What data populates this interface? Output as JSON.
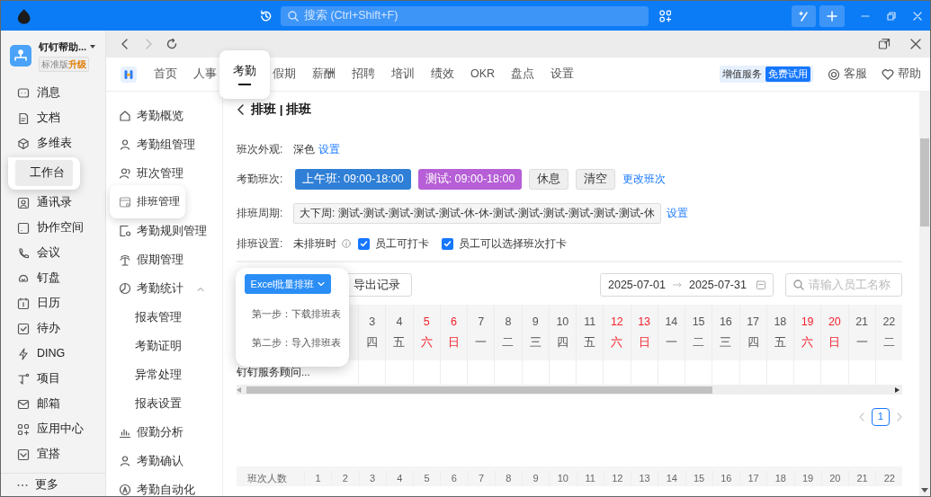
{
  "title_bar": {
    "search_placeholder": "搜索 (Ctrl+Shift+F)"
  },
  "org": {
    "name": "钉钉帮助...",
    "edition": "标准版",
    "upgrade": "升级"
  },
  "sidebar": {
    "items": [
      {
        "label": "消息",
        "selected": false
      },
      {
        "label": "文档",
        "selected": false
      },
      {
        "label": "多维表",
        "selected": false
      },
      {
        "label": "工作台",
        "selected": true
      },
      {
        "label": "通讯录",
        "selected": false
      },
      {
        "label": "协作空间",
        "selected": false
      },
      {
        "label": "会议",
        "selected": false
      },
      {
        "label": "钉盘",
        "selected": false
      },
      {
        "label": "日历",
        "selected": false
      },
      {
        "label": "待办",
        "selected": false
      },
      {
        "label": "DING",
        "selected": false
      },
      {
        "label": "项目",
        "selected": false
      },
      {
        "label": "邮箱",
        "selected": false
      },
      {
        "label": "应用中心",
        "selected": false
      },
      {
        "label": "宜搭",
        "selected": false
      }
    ],
    "more": "更多"
  },
  "app_tabs": [
    {
      "label": "首页",
      "selected": false
    },
    {
      "label": "人事",
      "selected": false
    },
    {
      "label": "考勤",
      "selected": true
    },
    {
      "label": "假期",
      "selected": false
    },
    {
      "label": "薪酬",
      "selected": false
    },
    {
      "label": "招聘",
      "selected": false
    },
    {
      "label": "培训",
      "selected": false
    },
    {
      "label": "绩效",
      "selected": false
    },
    {
      "label": "OKR",
      "selected": false
    },
    {
      "label": "盘点",
      "selected": false
    },
    {
      "label": "设置",
      "selected": false
    }
  ],
  "value_added": {
    "label": "增值服务",
    "badge": "免费试用"
  },
  "header_links": [
    {
      "label": "客服"
    },
    {
      "label": "帮助"
    }
  ],
  "menu": [
    {
      "label": "考勤概览",
      "selected": false
    },
    {
      "label": "考勤组管理",
      "selected": false
    },
    {
      "label": "班次管理",
      "selected": false
    },
    {
      "label": "排班管理",
      "selected": true
    },
    {
      "label": "考勤规则管理",
      "selected": false
    },
    {
      "label": "假期管理",
      "selected": false
    },
    {
      "label": "考勤统计",
      "selected": false,
      "expanded": true,
      "children": [
        {
          "label": "报表管理",
          "selected": false
        },
        {
          "label": "考勤证明",
          "selected": false
        },
        {
          "label": "异常处理",
          "selected": false
        },
        {
          "label": "报表设置",
          "selected": false
        }
      ]
    },
    {
      "label": "假勤分析",
      "selected": false
    },
    {
      "label": "考勤确认",
      "selected": false
    },
    {
      "label": "考勤自动化",
      "selected": false
    }
  ],
  "page": {
    "title": "排班 | 排班"
  },
  "appearance": {
    "label": "班次外观:",
    "value": "深色",
    "link": "设置"
  },
  "shifts": {
    "label": "考勤班次:",
    "items": [
      {
        "label": "上午班: 09:00-18:00",
        "kind": "shift",
        "color": "#2f7fd6"
      },
      {
        "label": "测试: 09:00-18:00",
        "kind": "shift",
        "color": "#b65fd6"
      },
      {
        "label": "休息",
        "kind": "plain"
      },
      {
        "label": "清空",
        "kind": "plain"
      }
    ],
    "link": "更改班次"
  },
  "cycle": {
    "label": "排班周期:",
    "value": "大下周: 测试-测试-测试-测试-测试-休-休-测试-测试-测试-测试-测试-测试-休",
    "link": "设置"
  },
  "schedule_settings": {
    "label": "排班设置:",
    "text": "未排班时",
    "options": [
      {
        "label": "员工可打卡",
        "checked": true
      },
      {
        "label": "员工可以选择班次打卡",
        "checked": true
      }
    ]
  },
  "toolbar": {
    "excel_button": "Excel批量排班",
    "menu_open": true,
    "excel_menu": [
      {
        "label": "第一步：下载排班表"
      },
      {
        "label": "第二步：导入排班表"
      }
    ],
    "export_button": "导出记录",
    "date_start": "2025-07-01",
    "date_end": "2025-07-31",
    "search_placeholder": "请输入员工名称"
  },
  "grid": {
    "days": [
      {
        "day": "3",
        "weekday": "四",
        "weekend": false
      },
      {
        "day": "4",
        "weekday": "五",
        "weekend": false
      },
      {
        "day": "5",
        "weekday": "六",
        "weekend": true
      },
      {
        "day": "6",
        "weekday": "日",
        "weekend": true
      },
      {
        "day": "7",
        "weekday": "一",
        "weekend": false
      },
      {
        "day": "8",
        "weekday": "二",
        "weekend": false
      },
      {
        "day": "9",
        "weekday": "三",
        "weekend": false
      },
      {
        "day": "10",
        "weekday": "四",
        "weekend": false
      },
      {
        "day": "11",
        "weekday": "五",
        "weekend": false
      },
      {
        "day": "12",
        "weekday": "六",
        "weekend": true
      },
      {
        "day": "13",
        "weekday": "日",
        "weekend": true
      },
      {
        "day": "14",
        "weekday": "一",
        "weekend": false
      },
      {
        "day": "15",
        "weekday": "二",
        "weekend": false
      },
      {
        "day": "16",
        "weekday": "三",
        "weekend": false
      },
      {
        "day": "17",
        "weekday": "四",
        "weekend": false
      },
      {
        "day": "18",
        "weekday": "五",
        "weekend": false
      },
      {
        "day": "19",
        "weekday": "六",
        "weekend": true
      },
      {
        "day": "20",
        "weekday": "日",
        "weekend": true
      },
      {
        "day": "21",
        "weekday": "一",
        "weekend": false
      },
      {
        "day": "22",
        "weekday": "二",
        "weekend": false
      }
    ],
    "rows": [
      {
        "name": "钉钉服务顾问..."
      }
    ]
  },
  "pagination": [
    {
      "label": "1",
      "selected": true
    }
  ],
  "stats": {
    "label": "班次人数",
    "days": [
      "1",
      "2",
      "3",
      "4",
      "5",
      "6",
      "7",
      "8",
      "9",
      "10",
      "11",
      "12",
      "13",
      "14",
      "15",
      "16",
      "17",
      "18",
      "19",
      "20",
      "21",
      "22"
    ]
  }
}
